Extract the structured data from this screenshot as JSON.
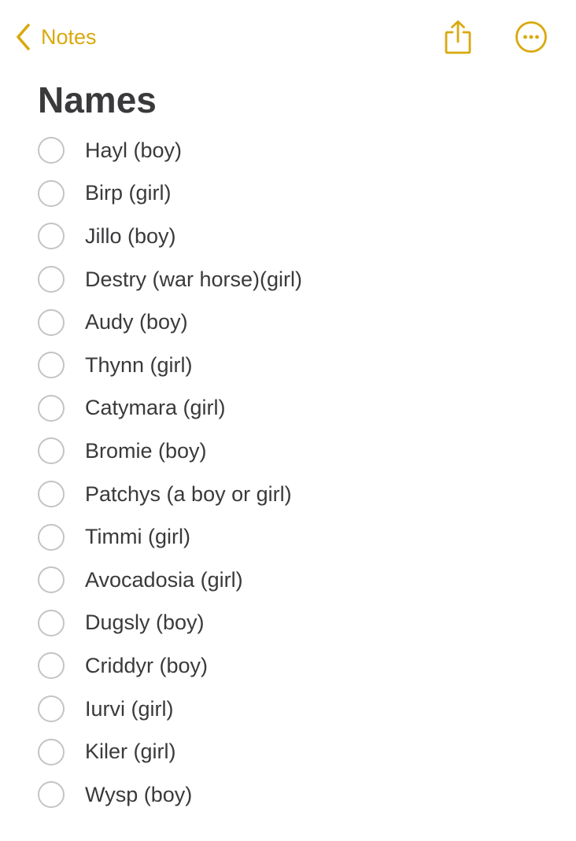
{
  "colors": {
    "accent": "#d9a90e",
    "text": "#3a3a3c",
    "checkbox_border": "#c4c4c6",
    "background": "#ffffff"
  },
  "nav": {
    "back_label": "Notes",
    "back_icon": "chevron-left-icon",
    "share_icon": "share-icon",
    "more_icon": "ellipsis-circle-icon"
  },
  "note": {
    "title": "Names",
    "checklist": [
      {
        "text": "Hayl (boy)",
        "checked": false
      },
      {
        "text": "Birp (girl)",
        "checked": false
      },
      {
        "text": "Jillo (boy)",
        "checked": false
      },
      {
        "text": "Destry (war horse)(girl)",
        "checked": false
      },
      {
        "text": "Audy (boy)",
        "checked": false
      },
      {
        "text": "Thynn (girl)",
        "checked": false
      },
      {
        "text": "Catymara (girl)",
        "checked": false
      },
      {
        "text": "Bromie (boy)",
        "checked": false
      },
      {
        "text": "Patchys (a boy or girl)",
        "checked": false
      },
      {
        "text": "Timmi (girl)",
        "checked": false
      },
      {
        "text": "Avocadosia (girl)",
        "checked": false
      },
      {
        "text": "Dugsly (boy)",
        "checked": false
      },
      {
        "text": "Criddyr (boy)",
        "checked": false
      },
      {
        "text": "Iurvi (girl)",
        "checked": false
      },
      {
        "text": "Kiler (girl)",
        "checked": false
      },
      {
        "text": "Wysp (boy)",
        "checked": false
      }
    ]
  }
}
